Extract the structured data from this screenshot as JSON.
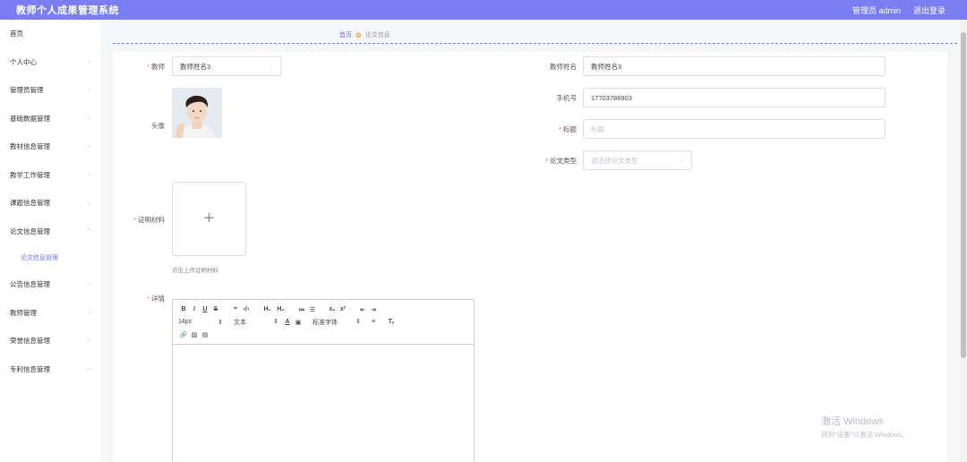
{
  "header": {
    "app_title": "教师个人成果管理系统",
    "user_label": "管理员 admin",
    "logout_label": "退出登录",
    "accent_color": "#7b7ef2"
  },
  "sidebar": {
    "items": [
      {
        "label": "首页"
      },
      {
        "label": "个人中心"
      },
      {
        "label": "管理员管理"
      },
      {
        "label": "基础数据管理"
      },
      {
        "label": "教材信息管理"
      },
      {
        "label": "教学工作管理"
      },
      {
        "label": "课题信息管理"
      },
      {
        "label": "论文信息管理"
      },
      {
        "label": "公告信息管理"
      },
      {
        "label": "教师管理"
      },
      {
        "label": "荣誉信息管理"
      },
      {
        "label": "专利信息管理"
      }
    ],
    "active_sub_item": "论文信息管理"
  },
  "breadcrumb": {
    "home": "首页",
    "current": "论文信息"
  },
  "form": {
    "teacher_label": "教师",
    "teacher_value": "教师姓名3",
    "avatar_label": "头像",
    "proof_label": "证明材料",
    "upload_tip": "点击上传证明材料",
    "detail_label": "详情",
    "teacher_name_label": "教师姓名",
    "teacher_name_value": "教师姓名3",
    "phone_label": "手机号",
    "phone_value": "17703786903",
    "title_label": "标题",
    "title_placeholder": "标题",
    "type_label": "论文类型",
    "type_placeholder": "请选择论文类型"
  },
  "editor": {
    "font_size": "14px",
    "block_format": "文本",
    "font_family": "标准字体"
  },
  "watermark": {
    "line1": "激活 Windows",
    "line2": "转到\"设置\"以激活 Windows。"
  }
}
